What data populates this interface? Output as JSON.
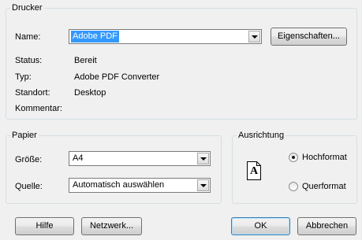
{
  "printer": {
    "legend": "Drucker",
    "name_label": "Name:",
    "name_value": "Adobe PDF",
    "properties_button": "Eigenschaften...",
    "status_label": "Status:",
    "status_value": "Bereit",
    "type_label": "Typ:",
    "type_value": "Adobe PDF Converter",
    "location_label": "Standort:",
    "location_value": "Desktop",
    "comment_label": "Kommentar:"
  },
  "paper": {
    "legend": "Papier",
    "size_label": "Größe:",
    "size_value": "A4",
    "source_label": "Quelle:",
    "source_value": "Automatisch auswählen"
  },
  "orientation": {
    "legend": "Ausrichtung",
    "portrait_label": "Hochformat",
    "landscape_label": "Querformat",
    "selected": "Hochformat",
    "page_glyph": "A"
  },
  "buttons": {
    "help": "Hilfe",
    "network": "Netzwerk...",
    "ok": "OK",
    "cancel": "Abbrechen"
  }
}
